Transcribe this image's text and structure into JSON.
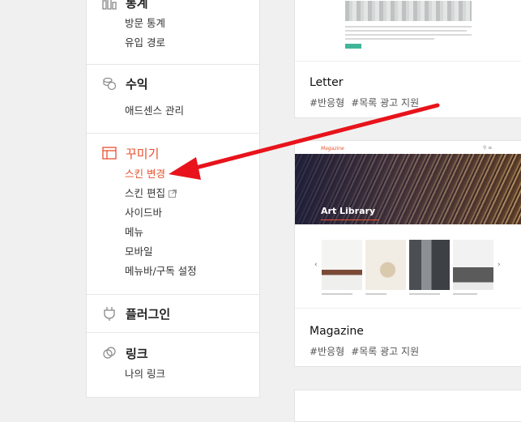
{
  "sidebar": {
    "stats": {
      "title": "통계",
      "items": [
        "방문 통계",
        "유입 경로"
      ]
    },
    "revenue": {
      "title": "수익",
      "items": [
        "애드센스 관리"
      ]
    },
    "decorate": {
      "title": "꾸미기",
      "items": [
        "스킨 변경",
        "스킨 편집",
        "사이드바",
        "메뉴",
        "모바일",
        "메뉴바/구독 설정"
      ],
      "active_item": "스킨 변경"
    },
    "plugin": {
      "title": "플러그인"
    },
    "link": {
      "title": "링크",
      "items": [
        "나의 링크"
      ]
    }
  },
  "skins": [
    {
      "name": "Letter",
      "tags": [
        "#반응형",
        "#목록 광고 지원"
      ]
    },
    {
      "name": "Magazine",
      "tags": [
        "#반응형",
        "#목록 광고 지원"
      ],
      "preview": {
        "logo": "Magazine",
        "hero_title": "Art Library"
      }
    }
  ],
  "colors": {
    "accent": "#e8512f",
    "arrow": "#e8131b"
  }
}
